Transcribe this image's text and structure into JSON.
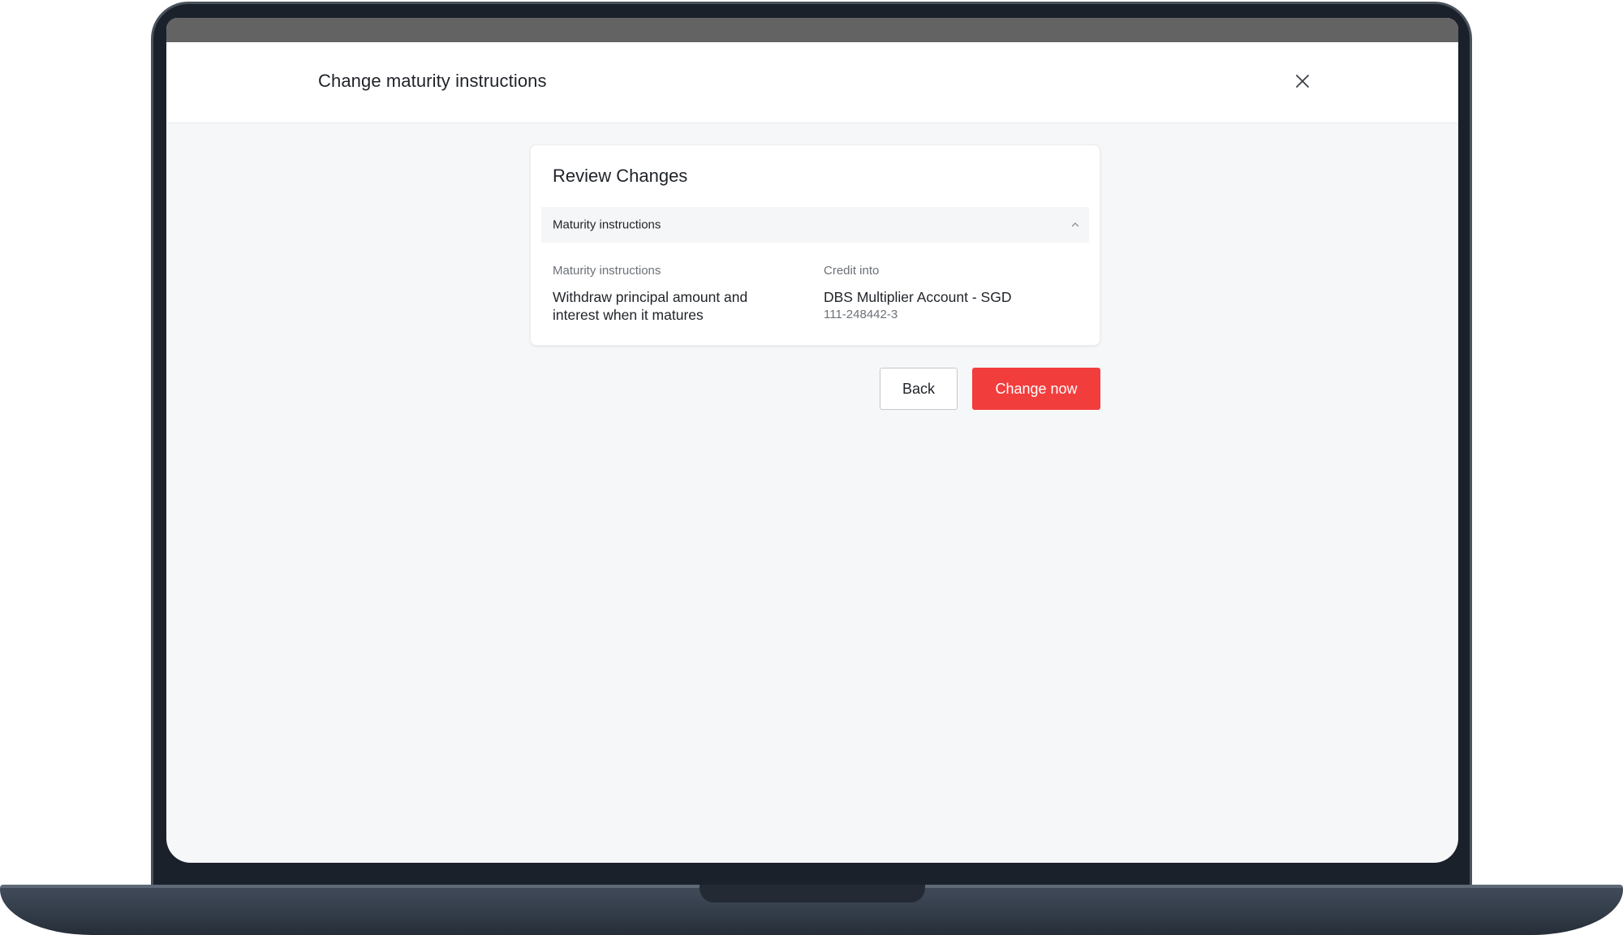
{
  "header": {
    "title": "Change maturity instructions",
    "close_icon": "close-icon"
  },
  "review": {
    "title": "Review Changes",
    "section": {
      "title": "Maturity instructions",
      "expanded": true,
      "chevron_icon": "chevron-up-icon"
    },
    "maturity_instructions": {
      "label": "Maturity instructions",
      "value": "Withdraw principal amount and interest when it matures"
    },
    "credit_into": {
      "label": "Credit into",
      "account_name": "DBS Multiplier Account - SGD",
      "account_number": "111-248442-3"
    }
  },
  "actions": {
    "back_label": "Back",
    "change_label": "Change now"
  },
  "colors": {
    "primary_button": "#f23d3d",
    "text_primary": "#1f2328",
    "text_secondary": "#6b7178",
    "page_background": "#f6f7f8"
  }
}
